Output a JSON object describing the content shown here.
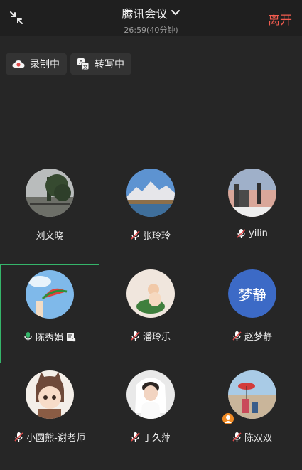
{
  "header": {
    "title": "腾讯会议",
    "duration": "26:59(40分钟)",
    "leave_label": "离开"
  },
  "chips": {
    "recording_label": "录制中",
    "transcribe_label": "转写中"
  },
  "participants": [
    {
      "name": "刘文晓",
      "mic": "none"
    },
    {
      "name": "张玲玲",
      "mic": "muted"
    },
    {
      "name": "yilin",
      "mic": "muted"
    },
    {
      "name": "陈秀娟",
      "mic": "on",
      "active_speaker": true,
      "extra_icon": "document-icon"
    },
    {
      "name": "潘玲乐",
      "mic": "muted"
    },
    {
      "name": "赵梦静",
      "mic": "muted",
      "avatar_text": "梦静",
      "avatar_color": "#3c6ac6"
    },
    {
      "name": "小圆熊-谢老师",
      "mic": "muted"
    },
    {
      "name": "丁久萍",
      "mic": "muted"
    },
    {
      "name": "陈双双",
      "mic": "muted",
      "host_badge": true
    }
  ],
  "colors": {
    "leave": "#f25c4f",
    "active_border": "#35b56a",
    "mic_on": "#35b56a",
    "mic_muted": "#e04a4a"
  }
}
